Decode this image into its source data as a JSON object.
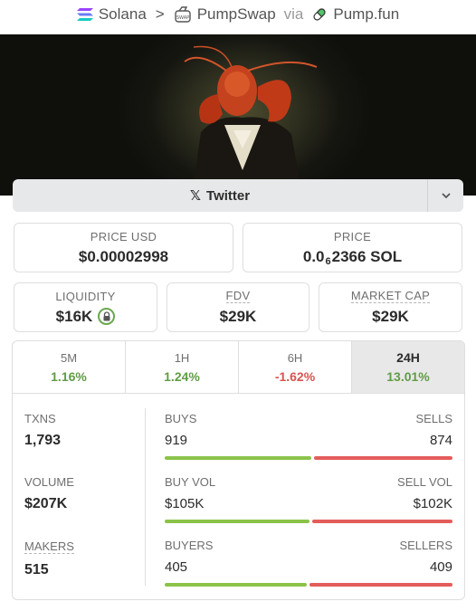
{
  "breadcrumb": {
    "chain": "Solana",
    "dex": "PumpSwap",
    "via": "via",
    "launchpad": "Pump.fun"
  },
  "social": {
    "twitter_label": "Twitter"
  },
  "price": {
    "usd_label": "PRICE USD",
    "usd_value": "$0.00002998",
    "native_label": "PRICE",
    "native_prefix": "0.0",
    "native_zero_count": "6",
    "native_digits": "2366 SOL"
  },
  "metrics": {
    "liquidity_label": "LIQUIDITY",
    "liquidity_value": "$16K",
    "fdv_label": "FDV",
    "fdv_value": "$29K",
    "mcap_label": "MARKET CAP",
    "mcap_value": "$29K"
  },
  "timeframes": [
    {
      "label": "5M",
      "change": "1.16%",
      "direction": "up"
    },
    {
      "label": "1H",
      "change": "1.24%",
      "direction": "up"
    },
    {
      "label": "6H",
      "change": "-1.62%",
      "direction": "down"
    },
    {
      "label": "24H",
      "change": "13.01%",
      "direction": "up",
      "selected": true
    }
  ],
  "stats": {
    "txns": {
      "label": "TXNS",
      "value": "1,793",
      "buys_label": "BUYS",
      "buys": "919",
      "sells_label": "SELLS",
      "sells": "874",
      "buy_share": 0.513
    },
    "volume": {
      "label": "VOLUME",
      "value": "$207K",
      "buy_label": "BUY VOL",
      "buy": "$105K",
      "sell_label": "SELL VOL",
      "sell": "$102K",
      "buy_share": 0.507
    },
    "makers": {
      "label": "MAKERS",
      "value": "515",
      "buyers_label": "BUYERS",
      "buyers": "405",
      "sellers_label": "SELLERS",
      "sellers": "409",
      "buy_share": 0.498
    }
  },
  "colors": {
    "positive": "#5f9c45",
    "negative": "#d9534f",
    "buy_bar": "#8bc34a",
    "sell_bar": "#e35d5b"
  }
}
